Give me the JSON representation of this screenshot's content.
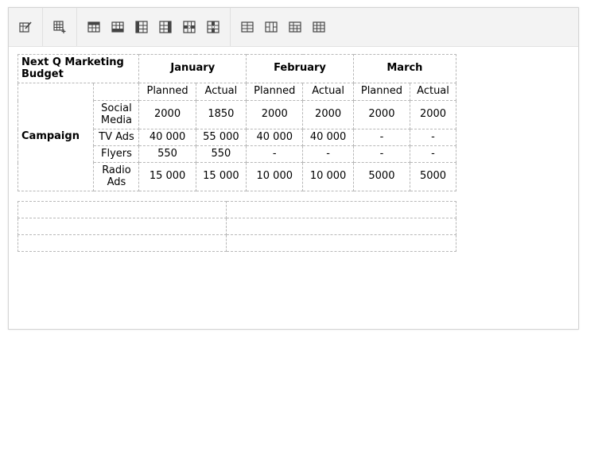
{
  "toolbar": {
    "groups": [
      [
        {
          "name": "table-properties-icon"
        }
      ],
      [
        {
          "name": "insert-table-icon"
        }
      ],
      [
        {
          "name": "row-header-icon"
        },
        {
          "name": "row-footer-icon"
        },
        {
          "name": "column-left-icon"
        },
        {
          "name": "column-right-icon"
        },
        {
          "name": "delete-row-icon"
        },
        {
          "name": "delete-column-icon"
        }
      ],
      [
        {
          "name": "merge-cells-icon"
        },
        {
          "name": "split-cells-icon"
        },
        {
          "name": "cell-props-icon"
        },
        {
          "name": "table-grid-icon"
        }
      ]
    ]
  },
  "table": {
    "title": "Next Q Marketing Budget",
    "months": [
      "January",
      "February",
      "March"
    ],
    "subheaders": [
      "Planned",
      "Actual",
      "Planned",
      "Actual",
      "Planned",
      "Actual"
    ],
    "group_label": "Campaign",
    "rows": [
      {
        "label": "Social Media",
        "values": [
          "2000",
          "1850",
          "2000",
          "2000",
          "2000",
          "2000"
        ]
      },
      {
        "label": "TV Ads",
        "values": [
          "40 000",
          "55 000",
          "40 000",
          "40 000",
          "-",
          "-"
        ]
      },
      {
        "label": "Flyers",
        "values": [
          "550",
          "550",
          "-",
          "-",
          "-",
          "-"
        ]
      },
      {
        "label": "Radio Ads",
        "values": [
          "15 000",
          "15 000",
          "10 000",
          "10 000",
          "5000",
          "5000"
        ]
      }
    ]
  },
  "empty_table": {
    "rows": 3,
    "cols": 2
  }
}
